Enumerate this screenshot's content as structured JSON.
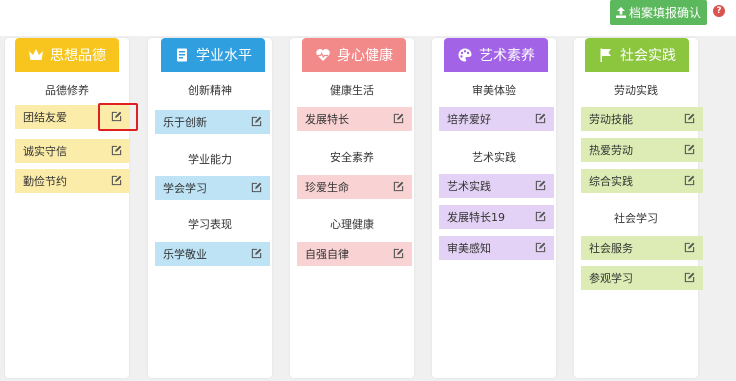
{
  "toolbar": {
    "confirm_label": "档案填报确认",
    "help_glyph": "?"
  },
  "columns": [
    {
      "title": "思想品德",
      "icon": "crown-icon",
      "color": "#f7c51e",
      "sections": [
        {
          "name": "品德修养",
          "items": [
            "团结友爱",
            "诚实守信",
            "勤俭节约"
          ]
        }
      ]
    },
    {
      "title": "学业水平",
      "icon": "book-icon",
      "color": "#2f9fe0",
      "sections": [
        {
          "name": "创新精神",
          "items": [
            "乐于创新"
          ]
        },
        {
          "name": "学业能力",
          "items": [
            "学会学习"
          ]
        },
        {
          "name": "学习表现",
          "items": [
            "乐学敬业"
          ]
        }
      ]
    },
    {
      "title": "身心健康",
      "icon": "heartbeat-icon",
      "color": "#f28a8a",
      "sections": [
        {
          "name": "健康生活",
          "items": [
            "发展特长"
          ]
        },
        {
          "name": "安全素养",
          "items": [
            "珍爱生命"
          ]
        },
        {
          "name": "心理健康",
          "items": [
            "自强自律"
          ]
        }
      ]
    },
    {
      "title": "艺术素养",
      "icon": "palette-icon",
      "color": "#a263e6",
      "sections": [
        {
          "name": "审美体验",
          "items": [
            "培养爱好"
          ]
        },
        {
          "name": "艺术实践",
          "items": [
            "艺术实践",
            "发展特长19",
            "审美感知"
          ]
        }
      ]
    },
    {
      "title": "社会实践",
      "icon": "flag-icon",
      "color": "#8cc63f",
      "sections": [
        {
          "name": "劳动实践",
          "items": [
            "劳动技能",
            "热爱劳动",
            "综合实践"
          ]
        },
        {
          "name": "社会学习",
          "items": [
            "社会服务",
            "参观学习"
          ]
        }
      ]
    }
  ]
}
